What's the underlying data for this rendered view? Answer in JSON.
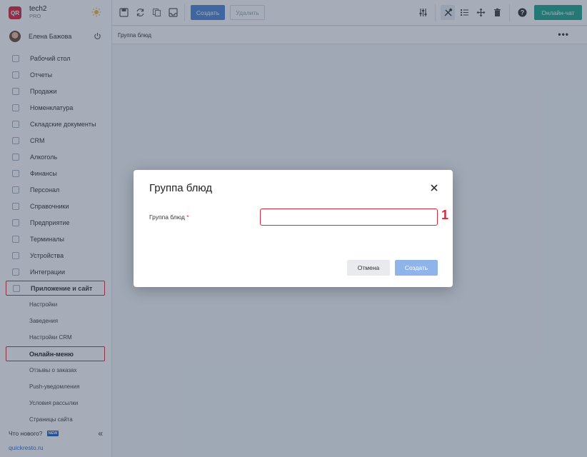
{
  "brand": {
    "logo_text": "QR",
    "name": "tech2",
    "plan": "PRO"
  },
  "user": {
    "name": "Елена Бажова"
  },
  "sidebar": {
    "items": [
      {
        "label": "Рабочий стол",
        "icon": "dashboard-icon"
      },
      {
        "label": "Отчеты",
        "icon": "reports-icon"
      },
      {
        "label": "Продажи",
        "icon": "sales-icon"
      },
      {
        "label": "Номенклатура",
        "icon": "nomenclature-icon"
      },
      {
        "label": "Складские документы",
        "icon": "warehouse-icon"
      },
      {
        "label": "CRM",
        "icon": "crm-icon"
      },
      {
        "label": "Алкоголь",
        "icon": "alcohol-icon"
      },
      {
        "label": "Финансы",
        "icon": "finance-icon"
      },
      {
        "label": "Персонал",
        "icon": "staff-icon"
      },
      {
        "label": "Справочники",
        "icon": "directory-icon"
      },
      {
        "label": "Предприятие",
        "icon": "enterprise-icon"
      },
      {
        "label": "Терминалы",
        "icon": "terminal-icon"
      },
      {
        "label": "Устройства",
        "icon": "devices-icon"
      },
      {
        "label": "Интеграции",
        "icon": "integrations-icon"
      },
      {
        "label": "Приложение и сайт",
        "icon": "app-site-icon"
      }
    ],
    "subitems": [
      {
        "label": "Настройки"
      },
      {
        "label": "Заведения"
      },
      {
        "label": "Настройки CRM"
      },
      {
        "label": "Онлайн-меню"
      },
      {
        "label": "Отзывы о заказах"
      },
      {
        "label": "Push-уведомления"
      },
      {
        "label": "Условия рассылки"
      },
      {
        "label": "Страницы сайта"
      }
    ],
    "whats_new": "Что нового?",
    "new_badge": "NEW",
    "collapse": "«",
    "site_link": "quickresto.ru"
  },
  "toolbar": {
    "create_label": "Создать",
    "delete_label": "Удалить",
    "chat_label": "Онлайн-чат",
    "help": "?"
  },
  "breadcrumb": {
    "current": "Группа блюд",
    "more": "•••"
  },
  "modal": {
    "title": "Группа блюд",
    "field_label": "Группа блюд",
    "required_mark": "*",
    "field_value": "",
    "marker": "1",
    "cancel_label": "Отмена",
    "create_label": "Создать"
  },
  "colors": {
    "accent": "#4e86d6",
    "chat": "#1fa48b",
    "highlight": "#d9263b",
    "brand_logo": "#d9263b"
  }
}
